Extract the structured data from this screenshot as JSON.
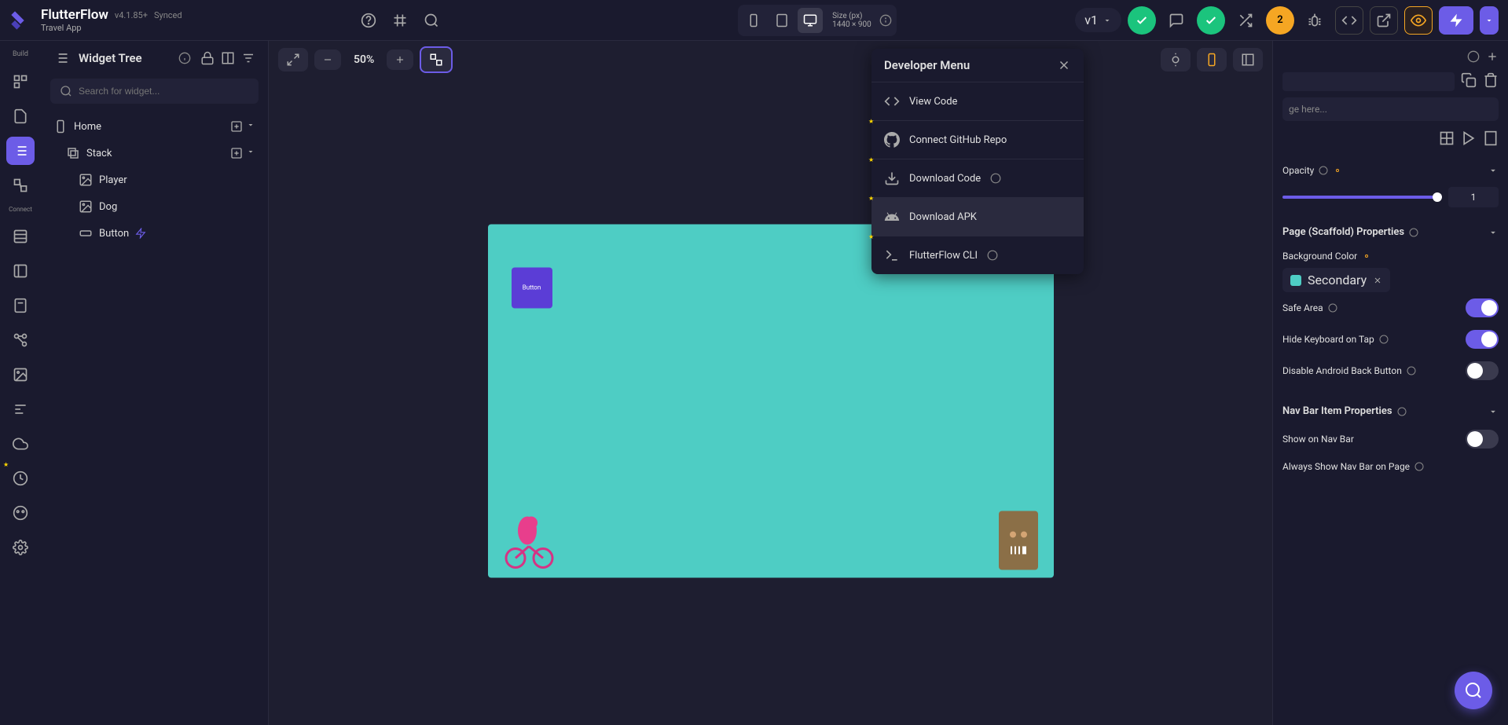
{
  "app": {
    "name": "FlutterFlow",
    "version": "v4.1.85+",
    "sync": "Synced",
    "subtitle": "Travel App"
  },
  "device": {
    "label": "Size (px)",
    "dimensions": "1440 × 900"
  },
  "version_selector": "v1",
  "warning_count": "2",
  "rail": {
    "build_label": "Build",
    "connect_label": "Connect"
  },
  "widget_panel": {
    "title": "Widget Tree",
    "search_placeholder": "Search for widget...",
    "tree": {
      "home": "Home",
      "stack": "Stack",
      "player": "Player",
      "dog": "Dog",
      "button": "Button"
    }
  },
  "canvas": {
    "zoom": "50%",
    "button_label": "Button"
  },
  "dev_menu": {
    "title": "Developer Menu",
    "items": {
      "view_code": "View Code",
      "connect_github": "Connect GitHub Repo",
      "download_code": "Download Code",
      "download_apk": "Download APK",
      "cli": "FlutterFlow CLI"
    }
  },
  "props": {
    "search_placeholder": "ge here...",
    "opacity_label": "Opacity",
    "opacity_value": "1",
    "scaffold_title": "Page (Scaffold) Properties",
    "bg_color_label": "Background Color",
    "bg_color_value": "Secondary",
    "safe_area": "Safe Area",
    "hide_keyboard": "Hide Keyboard on Tap",
    "disable_back": "Disable Android Back Button",
    "navbar_title": "Nav Bar Item Properties",
    "show_navbar": "Show on Nav Bar",
    "always_show": "Always Show Nav Bar on Page"
  }
}
